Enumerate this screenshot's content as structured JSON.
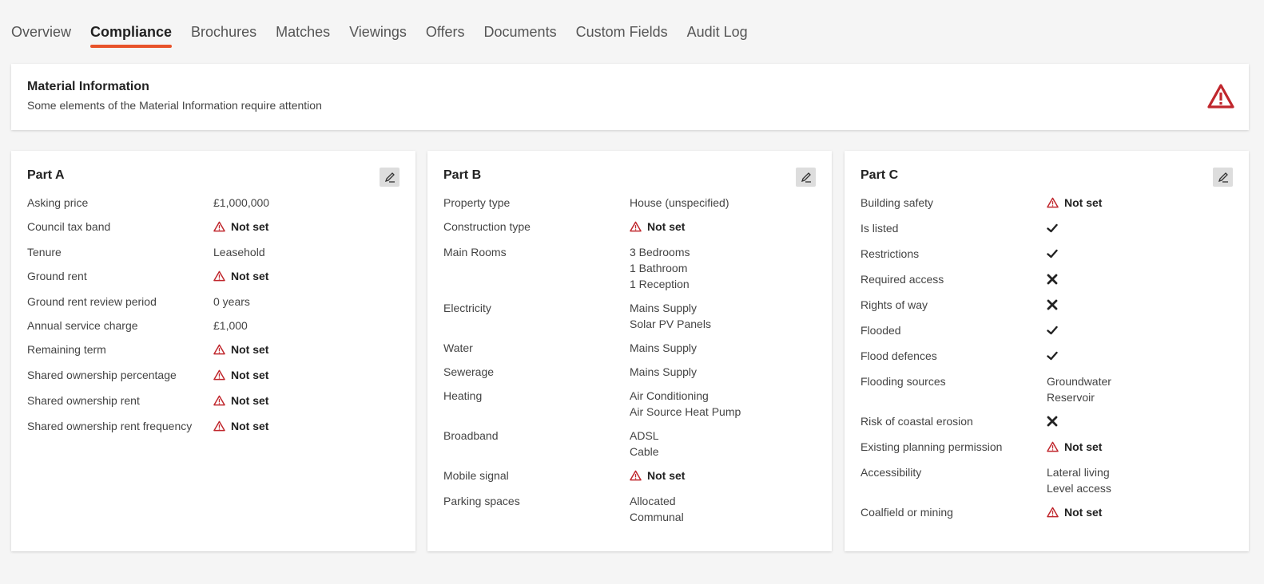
{
  "tabs": [
    "Overview",
    "Compliance",
    "Brochures",
    "Matches",
    "Viewings",
    "Offers",
    "Documents",
    "Custom Fields",
    "Audit Log"
  ],
  "active_tab": "Compliance",
  "banner": {
    "title": "Material Information",
    "subtitle": "Some elements of the Material Information require attention",
    "icon": "warning-triangle-icon",
    "icon_color": "#c0272d"
  },
  "not_set_text": "Not set",
  "parts": [
    {
      "title": "Part A",
      "rows": [
        {
          "label": "Asking price",
          "value": [
            "£1,000,000"
          ]
        },
        {
          "label": "Council tax band",
          "status": "not-set"
        },
        {
          "label": "Tenure",
          "value": [
            "Leasehold"
          ]
        },
        {
          "label": "Ground rent",
          "status": "not-set"
        },
        {
          "label": "Ground rent review period",
          "value": [
            "0 years"
          ]
        },
        {
          "label": "Annual service charge",
          "value": [
            "£1,000"
          ]
        },
        {
          "label": "Remaining term",
          "status": "not-set"
        },
        {
          "label": "Shared ownership percentage",
          "status": "not-set"
        },
        {
          "label": "Shared ownership rent",
          "status": "not-set"
        },
        {
          "label": "Shared ownership rent frequency",
          "status": "not-set"
        }
      ]
    },
    {
      "title": "Part B",
      "rows": [
        {
          "label": "Property type",
          "value": [
            "House (unspecified)"
          ]
        },
        {
          "label": "Construction type",
          "status": "not-set"
        },
        {
          "label": "Main Rooms",
          "value": [
            "3 Bedrooms",
            "1 Bathroom",
            "1 Reception"
          ]
        },
        {
          "label": "Electricity",
          "value": [
            "Mains Supply",
            "Solar PV Panels"
          ]
        },
        {
          "label": "Water",
          "value": [
            "Mains Supply"
          ]
        },
        {
          "label": "Sewerage",
          "value": [
            "Mains Supply"
          ]
        },
        {
          "label": "Heating",
          "value": [
            "Air Conditioning",
            "Air Source Heat Pump"
          ]
        },
        {
          "label": "Broadband",
          "value": [
            "ADSL",
            "Cable"
          ]
        },
        {
          "label": "Mobile signal",
          "status": "not-set"
        },
        {
          "label": "Parking spaces",
          "value": [
            "Allocated",
            "Communal"
          ]
        }
      ]
    },
    {
      "title": "Part C",
      "rows": [
        {
          "label": "Building safety",
          "status": "not-set"
        },
        {
          "label": "Is listed",
          "status": "yes"
        },
        {
          "label": "Restrictions",
          "status": "yes"
        },
        {
          "label": "Required access",
          "status": "no"
        },
        {
          "label": "Rights of way",
          "status": "no"
        },
        {
          "label": "Flooded",
          "status": "yes"
        },
        {
          "label": "Flood defences",
          "status": "yes"
        },
        {
          "label": "Flooding sources",
          "value": [
            "Groundwater",
            "Reservoir"
          ]
        },
        {
          "label": "Risk of coastal erosion",
          "status": "no"
        },
        {
          "label": "Existing planning permission",
          "status": "not-set"
        },
        {
          "label": "Accessibility",
          "value": [
            "Lateral living",
            "Level access"
          ]
        },
        {
          "label": "Coalfield or mining",
          "status": "not-set"
        }
      ]
    }
  ]
}
